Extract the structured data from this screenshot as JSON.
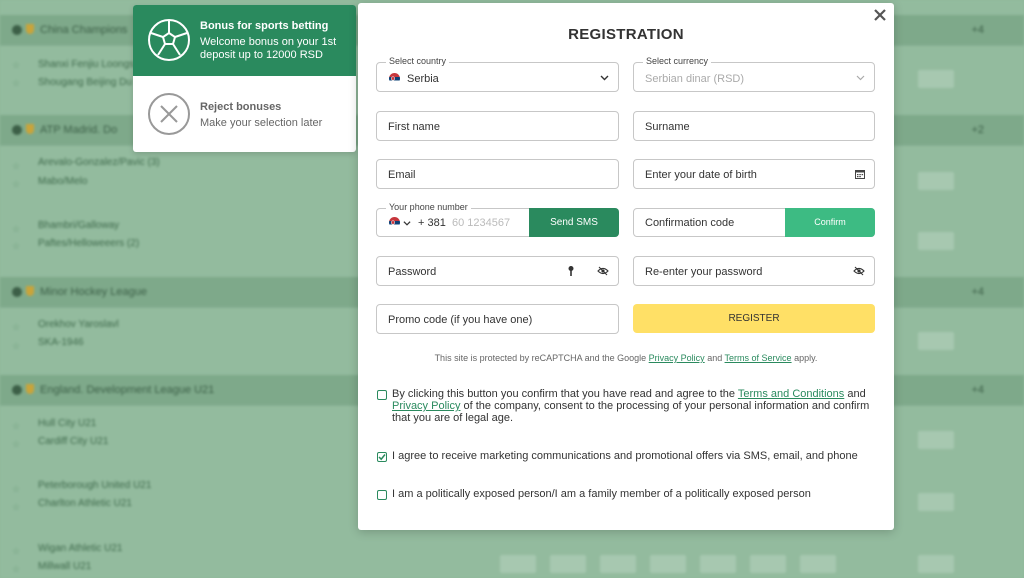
{
  "bonus": {
    "active_title": "Bonus for sports betting",
    "active_desc": "Welcome bonus on your 1st deposit up to 12000 RSD",
    "reject_title": "Reject bonuses",
    "reject_desc": "Make your selection later"
  },
  "modal": {
    "title": "REGISTRATION",
    "country": {
      "label": "Select country",
      "value": "Serbia"
    },
    "currency": {
      "label": "Select currency",
      "value": "Serbian dinar (RSD)"
    },
    "first_name": "First name",
    "surname": "Surname",
    "email": "Email",
    "dob": "Enter your date of birth",
    "phone": {
      "label": "Your phone number",
      "code": "+ 381",
      "placeholder": "60 1234567",
      "button": "Send SMS"
    },
    "confirmation": {
      "placeholder": "Confirmation code",
      "button": "Confirm"
    },
    "password": "Password",
    "reenter_password": "Re-enter your password",
    "promo": "Promo code (if you have one)",
    "register": "REGISTER",
    "captcha": {
      "pre": "This site is protected by reCAPTCHA and the Google ",
      "privacy": "Privacy Policy",
      "and": " and ",
      "terms": "Terms of Service",
      "post": " apply."
    },
    "terms_checkbox": {
      "pre": "By clicking this button you confirm that you have read and agree to the ",
      "terms_link": "Terms and Conditions",
      "mid": " and ",
      "privacy_link": "Privacy Policy",
      "post": " of the company, consent to the processing of your personal information and confirm that you are of legal age.",
      "checked": false
    },
    "marketing_checkbox": {
      "text": "I agree to receive marketing communications and promotional offers via SMS, email, and phone",
      "checked": true
    },
    "pep_checkbox": {
      "text": "I am a politically exposed person/I am a family member of a politically exposed person",
      "checked": false
    }
  },
  "background": {
    "leagues": [
      "China Champions",
      "ATP Madrid. Do",
      "Minor Hockey League",
      "England. Development League U21"
    ],
    "teams": [
      "Shanxi Fenjiu Loongs",
      "Shougang Beijing Du",
      "Arevalo-Gonzalez/Pavic (3)",
      "Mabo/Melo",
      "Bhambri/Galloway",
      "Paftes/Helloweeers (2)",
      "Orekhov Yaroslavl",
      "SKA-1946",
      "Hull City U21",
      "Cardiff City U21",
      "Peterborough United U21",
      "Charlton Athletic U21",
      "Wigan Athletic U21",
      "Millwall U21"
    ],
    "more_counts": [
      "+4",
      "+2",
      "+4",
      "+4"
    ]
  }
}
